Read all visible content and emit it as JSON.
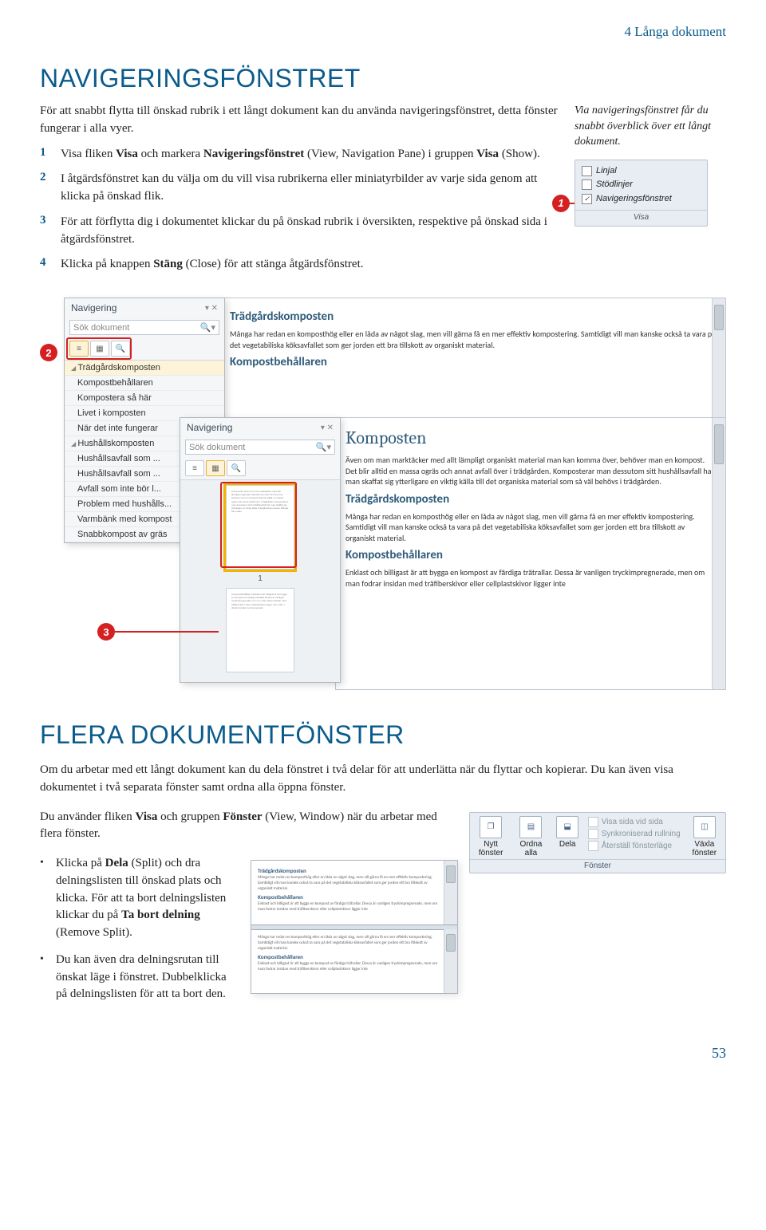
{
  "header": {
    "chapter": "4 Långa dokument"
  },
  "section1": {
    "title": "NAVIGERINGSFÖNSTRET",
    "intro": "För att snabbt flytta till önskad rubrik i ett långt dokument kan du använda navigeringsfönstret, detta fönster fungerar i alla vyer.",
    "sidenote": "Via navigeringsfönstret får du snabbt överblick över ett långt dokument.",
    "steps": {
      "n1": "1",
      "t1a": "Visa fliken ",
      "t1b": "Visa",
      "t1c": " och markera ",
      "t1d": "Navigeringsfönstret",
      "t1e": " (View, Navigation Pane) i gruppen ",
      "t1f": "Visa",
      "t1g": " (Show).",
      "n2": "2",
      "t2": "I åtgärdsfönstret kan du välja om du vill visa rubrikerna eller miniatyrbilder av varje sida genom att klicka på önskad flik.",
      "n3": "3",
      "t3": "För att förflytta dig i dokumentet klickar du på önskad rubrik i översikten, respektive på önskad sida i åtgärdsfönstret.",
      "n4": "4",
      "t4a": "Klicka på knappen ",
      "t4b": "Stäng",
      "t4c": " (Close) för att stänga åtgärdsfönstret."
    },
    "visaGroup": {
      "opt1": "Linjal",
      "opt2": "Stödlinjer",
      "opt3": "Navigeringsfönstret",
      "label": "Visa"
    },
    "callouts": {
      "c1": "1",
      "c2": "2",
      "c3": "3"
    },
    "navPane": {
      "title": "Navigering",
      "searchPlaceholder": "Sök dokument",
      "outline": [
        "Trädgårdskomposten",
        "Kompostbehållaren",
        "Kompostera så här",
        "Livet i komposten",
        "När det inte fungerar",
        "Hushållskomposten",
        "Hushållsavfall som ...",
        "Hushållsavfall som ...",
        "Avfall som inte bör l...",
        "Problem med hushålls...",
        "Varmbänk med kompost",
        "Snabbkompost av gräs"
      ],
      "thumbNum": "1"
    },
    "doc": {
      "h_tradgard": "Trädgårdskomposten",
      "p1": "Många har redan en komposthög eller en låda av något slag, men vill gärna få en mer effektiv kompostering. Samtidigt vill man kanske också ta vara på det vegetabiliska köksavfallet som ger jorden ett bra tillskott av organiskt material.",
      "h_behall": "Kompostbehållaren",
      "h_komposten": "Komposten",
      "p2": "Även om man marktäcker med allt lämpligt organiskt material man kan komma över, behöver man en kompost. Det blir alltid en massa ogräs och annat avfall över i trädgården. Komposterar man dessutom sitt hushållsavfall har man skaffat sig ytterligare en viktig källa till det organiska material som så väl behövs i trädgården.",
      "p3": "Många har redan en komposthög eller en låda av något slag, men vill gärna få en mer effektiv kompostering. Samtidigt vill man kanske också ta vara på det vegetabiliska köksavfallet som ger jorden ett bra tillskott av organiskt material.",
      "p4": "Enklast och billigast är att bygga en kompost av färdiga trätrallar. Dessa är vanligen tryckimpregnerade, men om man fodrar insidan med träfiberskivor eller cellplastskivor ligger inte"
    }
  },
  "section2": {
    "title": "FLERA DOKUMENTFÖNSTER",
    "p1": "Om du arbetar med ett långt dokument kan du dela fönstret i två delar för att underlätta när du flyttar och kopierar. Du kan även visa dokumentet i två separata fönster samt ordna alla öppna fönster.",
    "p2a": "Du använder fliken ",
    "p2b": "Visa",
    "p2c": " och gruppen ",
    "p2d": "Fönster",
    "p2e": " (View, Window) när du arbetar med flera fönster.",
    "b1a": "Klicka på ",
    "b1b": "Dela",
    "b1c": " (Split) och dra delningslisten till önskad plats och klicka. För att ta bort delningslisten klickar du på ",
    "b1d": "Ta bort delning",
    "b1e": " (Remove Split).",
    "b2": "Du kan även dra delningsrutan till önskat läge i fönstret. Dubbelklicka på delningslisten för att ta bort den.",
    "fonster": {
      "btn1": "Nytt fönster",
      "btn2": "Ordna alla",
      "btn3": "Dela",
      "small1": "Visa sida vid sida",
      "small2": "Synkroniserad rullning",
      "small3": "Återställ fönsterläge",
      "btn4": "Växla fönster",
      "label": "Fönster"
    }
  },
  "pageNumber": "53"
}
